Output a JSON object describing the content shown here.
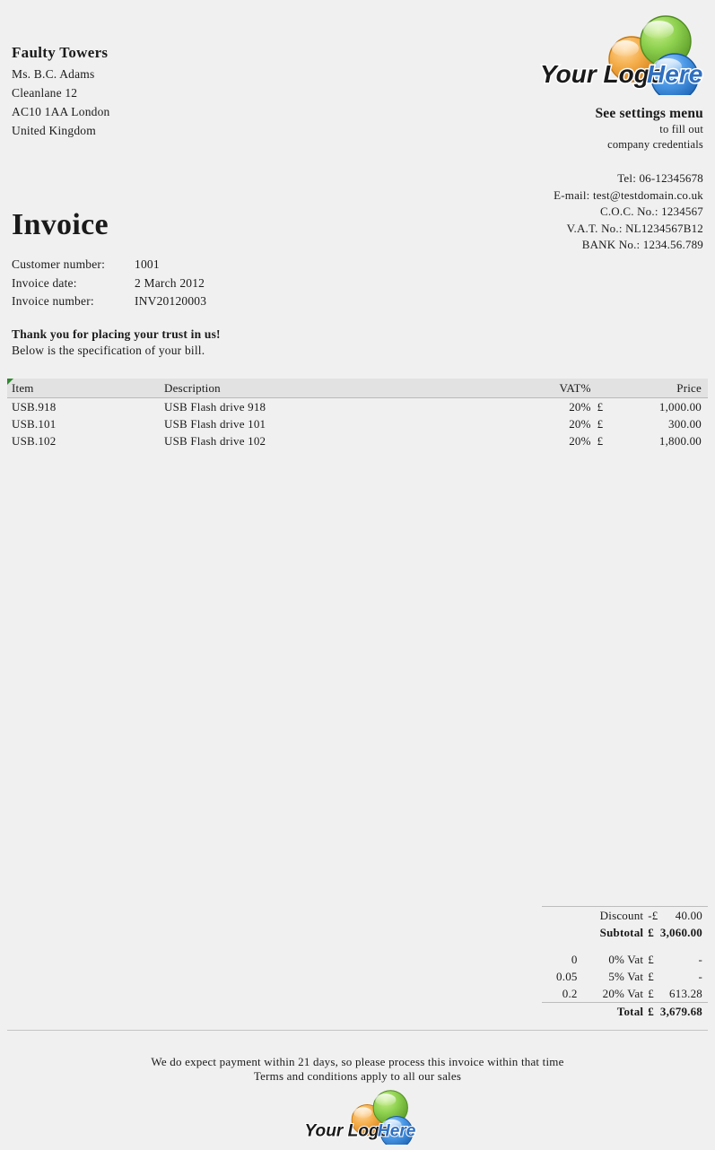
{
  "customer": {
    "name": "Faulty Towers",
    "lines": [
      "Ms. B.C. Adams",
      "Cleanlane 12",
      "AC10 1AA London",
      "United Kingdom"
    ]
  },
  "logo": {
    "text_dark": "Your Logo",
    "text_blue": "Here",
    "colors": {
      "green": "#7ac043",
      "orange": "#f0a030",
      "blue": "#3a8ee0",
      "text_blue": "#2f6fbf",
      "text_dark": "#1a1a1a"
    }
  },
  "company": {
    "heading": "See settings menu",
    "sub_line_1": "to fill out",
    "sub_line_2": "company credentials",
    "contacts": [
      "Tel: 06-12345678",
      "E-mail: test@testdomain.co.uk",
      "C.O.C. No.: 1234567",
      "V.A.T. No.: NL1234567B12",
      "BANK No.: 1234.56.789"
    ]
  },
  "invoice": {
    "title": "Invoice",
    "meta": [
      {
        "label": "Customer number:",
        "value": "1001"
      },
      {
        "label": "Invoice date:",
        "value": "2 March 2012"
      },
      {
        "label": "Invoice number:",
        "value": "INV20120003"
      }
    ],
    "thanks_heading": "Thank you for placing your trust in us!",
    "thanks_sub": "Below is the specification of your bill."
  },
  "items_table": {
    "headers": {
      "item": "Item",
      "description": "Description",
      "vat": "VAT%",
      "currency": "",
      "price": "Price"
    },
    "rows": [
      {
        "item": "USB.918",
        "description": "USB Flash drive 918",
        "vat": "20%",
        "currency": "£",
        "price": "1,000.00"
      },
      {
        "item": "USB.101",
        "description": "USB Flash drive 101",
        "vat": "20%",
        "currency": "£",
        "price": "300.00"
      },
      {
        "item": "USB.102",
        "description": "USB Flash drive 102",
        "vat": "20%",
        "currency": "£",
        "price": "1,800.00"
      }
    ]
  },
  "totals": {
    "discount": {
      "rate": "",
      "label": "Discount",
      "currency": "-£",
      "value": "40.00"
    },
    "subtotal": {
      "rate": "",
      "label": "Subtotal",
      "currency": "£",
      "value": "3,060.00"
    },
    "vat_rows": [
      {
        "rate": "0",
        "label": "0% Vat",
        "currency": "£",
        "value": "-"
      },
      {
        "rate": "0.05",
        "label": "5% Vat",
        "currency": "£",
        "value": "-"
      },
      {
        "rate": "0.2",
        "label": "20% Vat",
        "currency": "£",
        "value": "613.28"
      }
    ],
    "total": {
      "rate": "",
      "label": "Total",
      "currency": "£",
      "value": "3,679.68"
    }
  },
  "footer": {
    "line_1": "We do expect payment within 21 days, so please process this invoice within that time",
    "line_2": "Terms and conditions apply to all our sales"
  }
}
